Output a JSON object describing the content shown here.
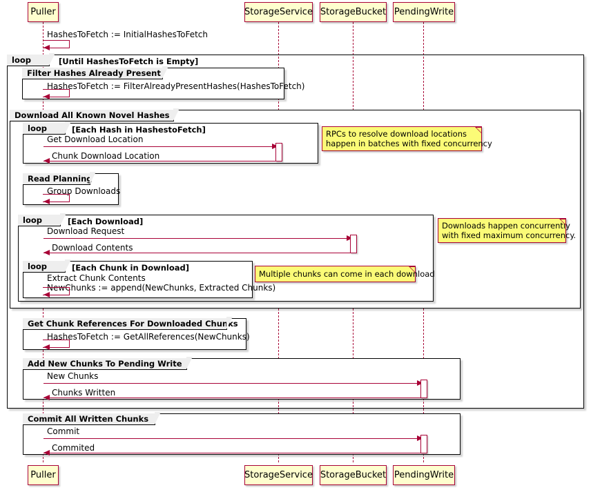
{
  "diagram": {
    "type": "sequence-diagram",
    "title": "",
    "accent_color": "#A80036",
    "participant_fill": "#FEFECE",
    "note_fill": "#FBFB77",
    "frame_label_fill": "#EEEEEE"
  },
  "participants": [
    {
      "id": "puller",
      "label": "Puller"
    },
    {
      "id": "storageservice",
      "label": "StorageService"
    },
    {
      "id": "storagebucket",
      "label": "StorageBucket"
    },
    {
      "id": "pendingwrite",
      "label": "PendingWrite"
    }
  ],
  "participants_footer": [
    {
      "id": "puller",
      "label": "Puller"
    },
    {
      "id": "storageservice",
      "label": "StorageService"
    },
    {
      "id": "storagebucket",
      "label": "StorageBucket"
    },
    {
      "id": "pendingwrite",
      "label": "PendingWrite"
    }
  ],
  "frames": {
    "outer_loop": {
      "keyword": "loop",
      "condition": "[Until HashesToFetch is Empty]"
    },
    "filter_group": {
      "title": "Filter Hashes Already Present"
    },
    "download_group": {
      "title": "Download All Known Novel Hashes"
    },
    "each_hash_loop": {
      "keyword": "loop",
      "condition": "[Each Hash in HashestoFetch]"
    },
    "read_planning_group": {
      "title": "Read Planning"
    },
    "each_download_loop": {
      "keyword": "loop",
      "condition": "[Each Download]"
    },
    "each_chunk_loop": {
      "keyword": "loop",
      "condition": "[Each Chunk in Download]"
    },
    "get_chunk_refs_group": {
      "title": "Get Chunk References For Downloaded Chunks"
    },
    "add_chunks_group": {
      "title": "Add New Chunks To Pending Write"
    },
    "commit_group": {
      "title": "Commit All Written Chunks"
    }
  },
  "messages": {
    "init": "HashesToFetch := InitialHashesToFetch",
    "filter": "HashesToFetch := FilterAlreadyPresentHashes(HashesToFetch)",
    "get_download_location": "Get Download Location",
    "chunk_download_location": "Chunk Download Location",
    "group_downloads": "Group Downloads",
    "download_request": "Download Request",
    "download_contents": "Download Contents",
    "extract_chunk_line1": "Extract Chunk Contents",
    "extract_chunk_line2": "NewChunks := append(NewChunks, Extracted Chunks)",
    "get_all_references": "HashesToFetch := GetAllReferences(NewChunks)",
    "new_chunks": "New Chunks",
    "chunks_written": "Chunks Written",
    "commit": "Commit",
    "commited": "Commited"
  },
  "notes": {
    "rpc_note": "RPCs to resolve download locations\nhappen in batches with fixed concurrency",
    "downloads_note": "Downloads happen concurrently\nwith fixed maximum concurrency.",
    "chunks_note": "Multiple chunks can come in each download"
  }
}
